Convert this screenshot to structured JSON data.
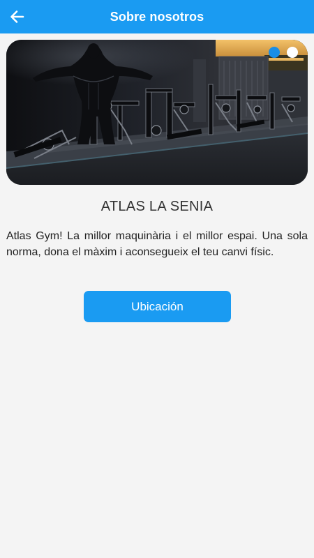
{
  "appbar": {
    "title": "Sobre nosotros",
    "back_icon": "arrow-left-icon",
    "background": "#1a9bf2"
  },
  "carousel": {
    "image": "gym-interior-photo",
    "slide_count": 2,
    "active_index": 0,
    "active_dot_color": "#1a8ee6",
    "inactive_dot_color": "#ffffff"
  },
  "about": {
    "title": "ATLAS LA SENIA",
    "description": "Atlas Gym! La millor maquinària i el millor espai. Una sola norma, dona el màxim i aconsegueix el teu canvi físic."
  },
  "location_button": {
    "label": "Ubicación",
    "color": "#1a9bf2"
  }
}
